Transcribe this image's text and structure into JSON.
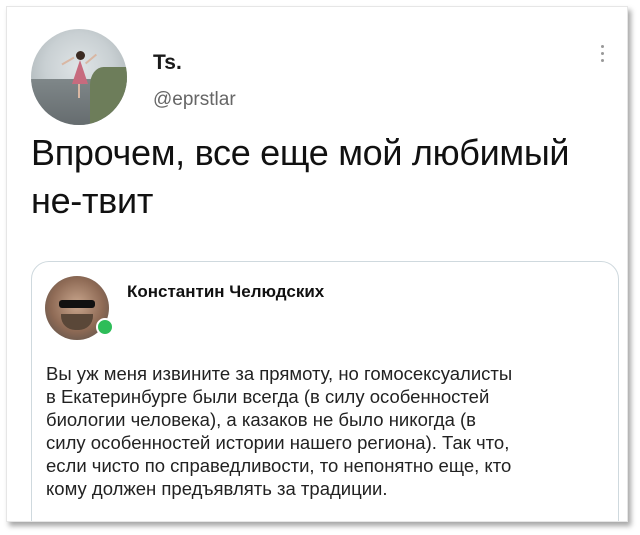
{
  "author": {
    "display_name": "Ts.",
    "handle": "@eprstlar"
  },
  "tweet": {
    "text": "Впрочем, все еще мой любимый не-твит"
  },
  "quoted": {
    "author_name": "Константин Челюдских",
    "text": "Вы уж меня извините за прямоту, но гомосексуалисты\nв Екатеринбурге были всегда (в силу особенностей\nбиологии человека), а казаков не было никогда (в\nсилу особенностей истории нашего региона). Так что,\nесли чисто по справедливости, то непонятно еще, кто\nкому должен предъявлять за традиции."
  },
  "colors": {
    "online_status": "#2ebd59",
    "quote_border": "#cfd9de"
  },
  "icons": {
    "more": "vertical-ellipsis"
  }
}
